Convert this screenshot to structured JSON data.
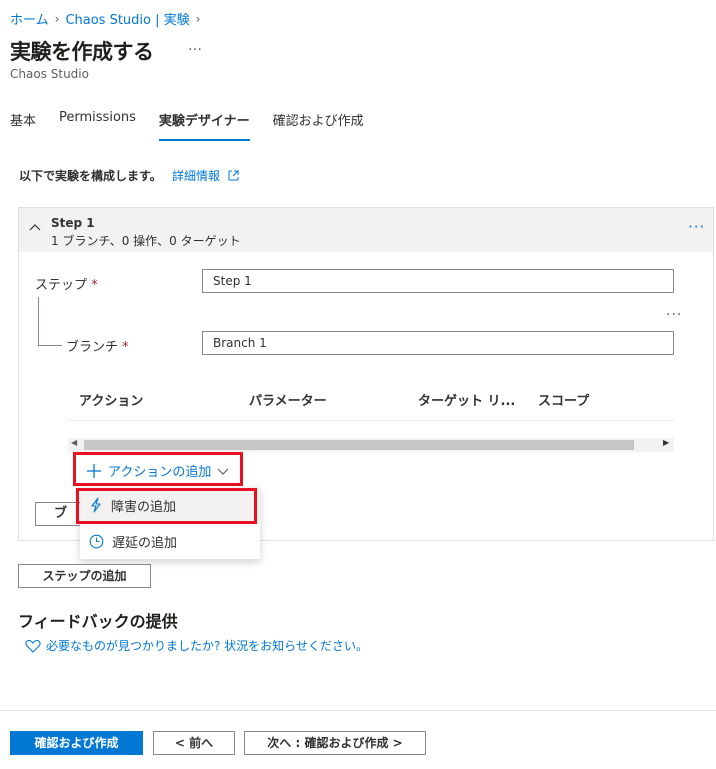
{
  "breadcrumb": {
    "home": "ホーム",
    "current": "Chaos Studio | 実験"
  },
  "page": {
    "title": "実験を作成する",
    "more": "…",
    "subtitle": "Chaos Studio"
  },
  "tabs": [
    {
      "label": "基本"
    },
    {
      "label": "Permissions"
    },
    {
      "label": "実験デザイナー",
      "active": true
    },
    {
      "label": "確認および作成"
    }
  ],
  "intro": {
    "text": "以下で実験を構成します。",
    "link": "詳細情報"
  },
  "step": {
    "name": "Step 1",
    "meta": "1 ブランチ、0 操作、0 ターゲット",
    "step_label": "ステップ",
    "step_value": "Step 1",
    "branch_label": "ブランチ",
    "branch_value": "Branch 1",
    "required_mark": "*",
    "more": "···"
  },
  "grid": {
    "columns": [
      "アクション",
      "パラメーター",
      "ターゲット リ...",
      "スコープ"
    ]
  },
  "add_action": {
    "label": "アクションの追加"
  },
  "branch_button_partial": "ブ",
  "dropdown": {
    "items": [
      {
        "label": "障害の追加",
        "icon": "lightning-icon"
      },
      {
        "label": "遅延の追加",
        "icon": "clock-icon"
      }
    ]
  },
  "add_step_button": "ステップの追加",
  "feedback": {
    "title": "フィードバックの提供",
    "link": "必要なものが見つかりましたか? 状況をお知らせください。"
  },
  "footer": {
    "primary": "確認および作成",
    "prev": "< 前へ",
    "next": "次へ : 確認および作成 >"
  },
  "colors": {
    "accent": "#0078d4",
    "highlight": "#e81123"
  }
}
